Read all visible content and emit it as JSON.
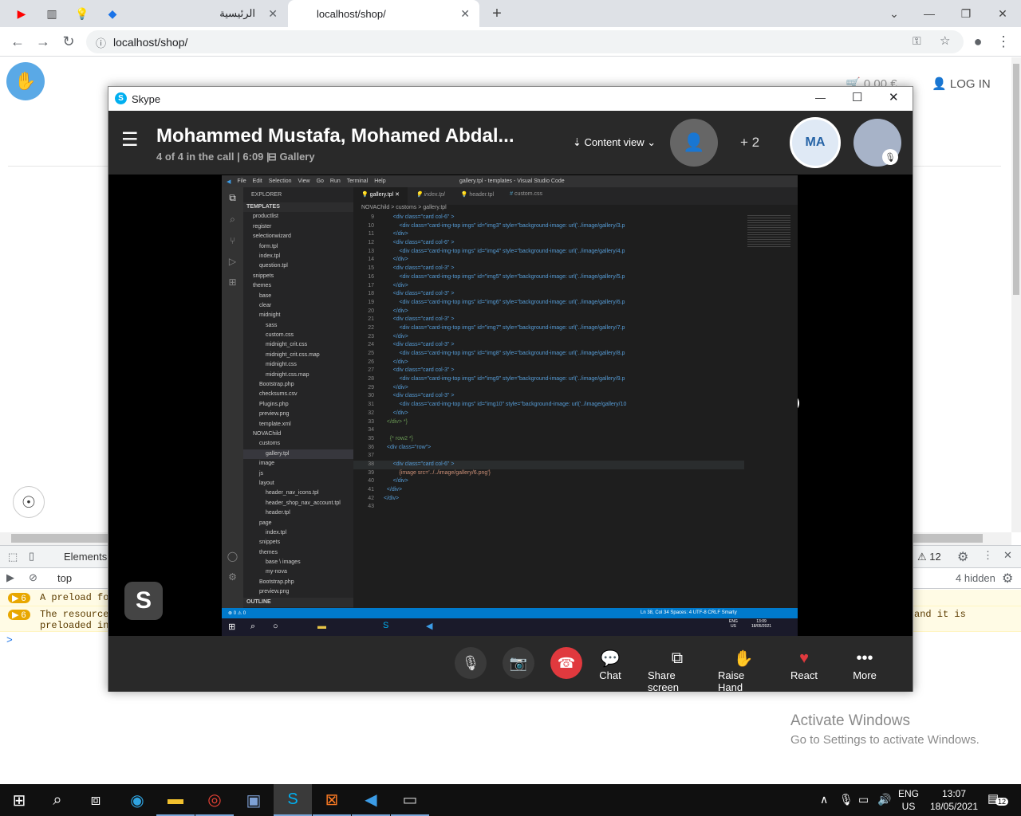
{
  "chrome": {
    "tabs": [
      {
        "label": "الرئيسية"
      },
      {
        "label": "localhost/shop/"
      }
    ],
    "url": "localhost/shop/"
  },
  "webpage": {
    "cart_total": "0.00 €",
    "login_label": "LOG IN"
  },
  "devtools": {
    "tab_elements": "Elements",
    "issues_count": "12",
    "context": "top",
    "hidden_count": "4 hidden",
    "messages": [
      {
        "count": "6",
        "text": "A preload for"
      },
      {
        "count": "6",
        "text": "The resource",
        "text2": "preloaded int",
        "tail": "and it is"
      }
    ],
    "prompt": ">"
  },
  "skype": {
    "app_title": "Skype",
    "call_title": "Mohammed Mustafa, Mohamed Abdal...",
    "call_info": "4 of 4 in the call | 6:09 |",
    "gallery_label": "Gallery",
    "content_view": "Content view",
    "extra_participants": "+ 2",
    "avatar_initials": "MA",
    "controls": [
      {
        "label": "Chat"
      },
      {
        "label": "Share screen"
      },
      {
        "label": "Raise Hand"
      },
      {
        "label": "React"
      },
      {
        "label": "More"
      }
    ]
  },
  "vscode": {
    "window_title": "gallery.tpl - templates - Visual Studio Code",
    "menu": [
      "File",
      "Edit",
      "Selection",
      "View",
      "Go",
      "Run",
      "Terminal",
      "Help"
    ],
    "explorer_label": "EXPLORER",
    "tabs": [
      "gallery.tpl",
      "index.tpl",
      "header.tpl",
      "custom.css"
    ],
    "breadcrumb": "NOVAChild > customs > gallery.tpl",
    "tree": [
      "TEMPLATES",
      "productlist",
      "register",
      "selectionwizard",
      "form.tpl",
      "index.tpl",
      "question.tpl",
      "snippets",
      "themes",
      "base",
      "clear",
      "midnight",
      "sass",
      "custom.css",
      "midnight_crit.css",
      "midnight_crit.css.map",
      "midnight.css",
      "midnight.css.map",
      "Bootstrap.php",
      "checksums.csv",
      "Plugins.php",
      "preview.png",
      "template.xml",
      "NOVAChild",
      "customs",
      "gallery.tpl",
      "image",
      "js",
      "layout",
      "header_nav_icons.tpl",
      "header_shop_nav_account.tpl",
      "header.tpl",
      "page",
      "index.tpl",
      "snippets",
      "themes",
      "base \\ images",
      "my-nova",
      "Bootstrap.php",
      "preview.png",
      "OUTLINE"
    ],
    "code": [
      {
        "n": "9",
        "t": "      <div class=\"card col-6\" >"
      },
      {
        "n": "10",
        "t": "          <div class=\"card-img-top imgs\" id=\"img3\" style=\"background-image: url('../image/gallery/3.p"
      },
      {
        "n": "11",
        "t": "      </div>"
      },
      {
        "n": "12",
        "t": "      <div class=\"card col-6\" >"
      },
      {
        "n": "13",
        "t": "          <div class=\"card-img-top imgs\" id=\"img4\" style=\"background-image: url('../image/gallery/4.p"
      },
      {
        "n": "14",
        "t": "      </div>"
      },
      {
        "n": "15",
        "t": "      <div class=\"card col-3\" >"
      },
      {
        "n": "16",
        "t": "          <div class=\"card-img-top imgs\" id=\"img5\" style=\"background-image: url('../image/gallery/5.p"
      },
      {
        "n": "17",
        "t": "      </div>"
      },
      {
        "n": "18",
        "t": "      <div class=\"card col-3\" >"
      },
      {
        "n": "19",
        "t": "          <div class=\"card-img-top imgs\" id=\"img6\" style=\"background-image: url('../image/gallery/6.p"
      },
      {
        "n": "20",
        "t": "      </div>"
      },
      {
        "n": "21",
        "t": "      <div class=\"card col-3\" >"
      },
      {
        "n": "22",
        "t": "          <div class=\"card-img-top imgs\" id=\"img7\" style=\"background-image: url('../image/gallery/7.p"
      },
      {
        "n": "23",
        "t": "      </div>"
      },
      {
        "n": "24",
        "t": "      <div class=\"card col-3\" >"
      },
      {
        "n": "25",
        "t": "          <div class=\"card-img-top imgs\" id=\"img8\" style=\"background-image: url('../image/gallery/8.p"
      },
      {
        "n": "26",
        "t": "      </div>"
      },
      {
        "n": "27",
        "t": "      <div class=\"card col-3\" >"
      },
      {
        "n": "28",
        "t": "          <div class=\"card-img-top imgs\" id=\"img9\" style=\"background-image: url('../image/gallery/9.p"
      },
      {
        "n": "29",
        "t": "      </div>"
      },
      {
        "n": "30",
        "t": "      <div class=\"card col-3\" >"
      },
      {
        "n": "31",
        "t": "          <div class=\"card-img-top imgs\" id=\"img10\" style=\"background-image: url('../image/gallery/10"
      },
      {
        "n": "32",
        "t": "      </div>"
      },
      {
        "n": "33",
        "t": "  </div> *}"
      },
      {
        "n": "34",
        "t": ""
      },
      {
        "n": "35",
        "t": "    {* row2 *}"
      },
      {
        "n": "36",
        "t": "  <div class=\"row\">"
      },
      {
        "n": "37",
        "t": ""
      },
      {
        "n": "38",
        "t": "      <div class=\"card col-6\" >"
      },
      {
        "n": "39",
        "t": "          {image src='../../image/gallery/6.png'}"
      },
      {
        "n": "40",
        "t": "      </div>"
      },
      {
        "n": "41",
        "t": "  </div>"
      },
      {
        "n": "42",
        "t": "</div>"
      },
      {
        "n": "43",
        "t": ""
      }
    ],
    "status_left": "⊗ 0 ⚠ 0",
    "status_right": "Ln 38, Col 34   Spaces: 4   UTF-8   CRLF   Smarty",
    "inner_clock": "13:09",
    "inner_date": "18/05/2021",
    "inner_lang": "ENG",
    "inner_region": "US"
  },
  "watermark": {
    "line1": "Activate Windows",
    "line2": "Go to Settings to activate Windows."
  },
  "taskbar": {
    "lang": "ENG",
    "region": "US",
    "time": "13:07",
    "date": "18/05/2021",
    "notifications": "12"
  }
}
